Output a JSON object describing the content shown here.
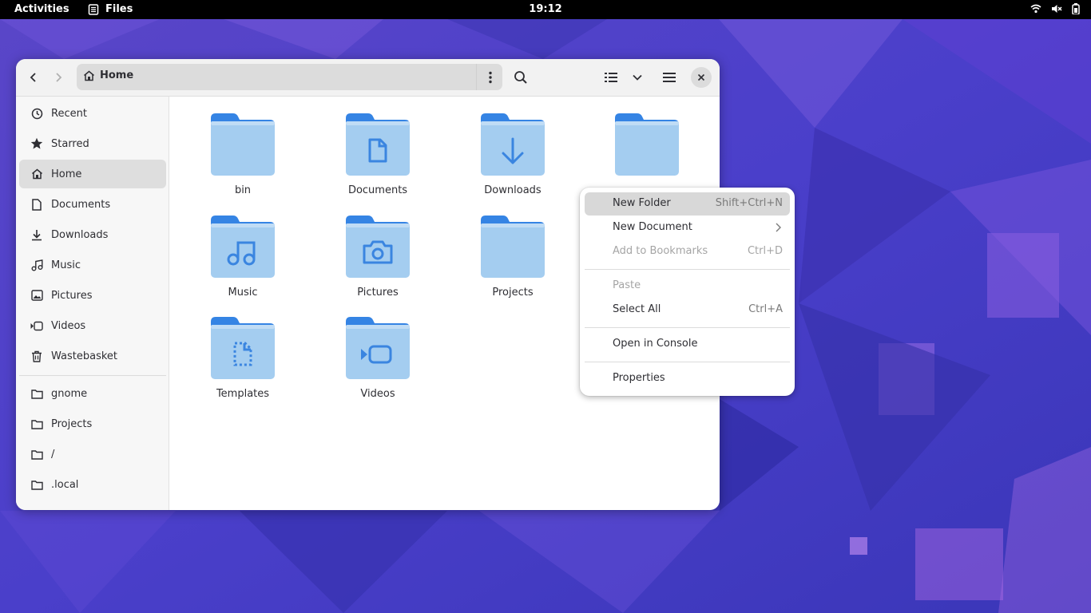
{
  "topbar": {
    "activities": "Activities",
    "app_name": "Files",
    "clock": "19:12",
    "icons": [
      "wifi-icon",
      "volume-muted-icon",
      "battery-icon"
    ]
  },
  "window": {
    "path": {
      "current": "Home"
    },
    "sidebar": {
      "places": [
        {
          "label": "Recent",
          "icon": "clock-icon"
        },
        {
          "label": "Starred",
          "icon": "star-icon"
        },
        {
          "label": "Home",
          "icon": "home-icon",
          "active": true
        },
        {
          "label": "Documents",
          "icon": "document-icon"
        },
        {
          "label": "Downloads",
          "icon": "download-icon"
        },
        {
          "label": "Music",
          "icon": "music-icon"
        },
        {
          "label": "Pictures",
          "icon": "picture-icon"
        },
        {
          "label": "Videos",
          "icon": "video-icon"
        },
        {
          "label": "Wastebasket",
          "icon": "trash-icon"
        }
      ],
      "bookmarks": [
        {
          "label": "gnome",
          "icon": "folder-icon"
        },
        {
          "label": "Projects",
          "icon": "folder-icon"
        },
        {
          "label": "/",
          "icon": "folder-icon"
        },
        {
          "label": ".local",
          "icon": "folder-icon"
        }
      ]
    },
    "files": [
      {
        "name": "bin",
        "emblem": "none"
      },
      {
        "name": "Documents",
        "emblem": "document"
      },
      {
        "name": "Downloads",
        "emblem": "download"
      },
      {
        "name": "Music",
        "emblem": "music"
      },
      {
        "name": "Pictures",
        "emblem": "camera"
      },
      {
        "name": "Projects",
        "emblem": "none"
      },
      {
        "name": "Templates",
        "emblem": "template"
      },
      {
        "name": "Videos",
        "emblem": "video"
      }
    ]
  },
  "context_menu": {
    "items": [
      {
        "label": "New Folder",
        "accel": "Shift+Ctrl+N",
        "state": "hover"
      },
      {
        "label": "New Document",
        "accel": "",
        "submenu": true
      },
      {
        "label": "Add to Bookmarks",
        "accel": "Ctrl+D",
        "state": "disabled"
      },
      {
        "label": "Paste",
        "accel": "",
        "state": "disabled"
      },
      {
        "label": "Select All",
        "accel": "Ctrl+A"
      },
      {
        "label": "Open in Console",
        "accel": ""
      },
      {
        "label": "Properties",
        "accel": ""
      }
    ]
  },
  "colors": {
    "folder_back": "#3584e4",
    "folder_front": "#a4cdf0",
    "emblem": "#3a85e0",
    "wallpaper": "#4b3fc4"
  }
}
